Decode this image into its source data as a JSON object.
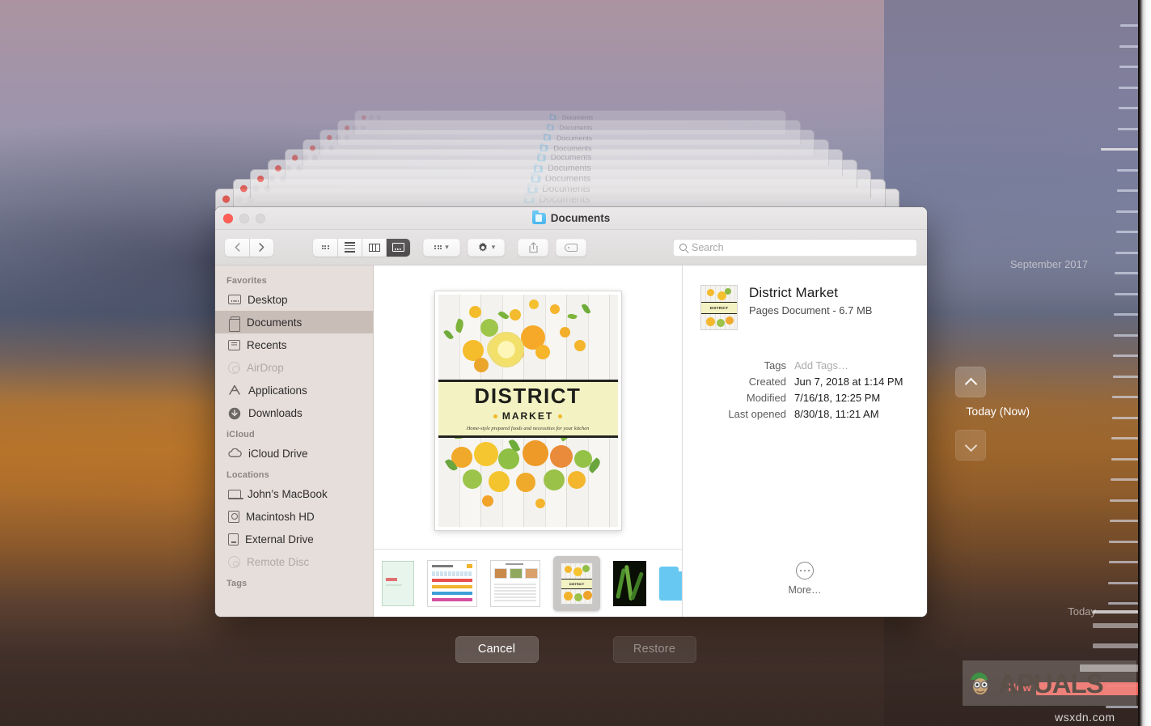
{
  "desktop": {
    "cascade_title": "Documents",
    "cascade_count": 9
  },
  "window": {
    "title": "Documents",
    "folder_icon": "folder-icon",
    "traffic_lights": [
      "close",
      "minimize",
      "zoom"
    ]
  },
  "toolbar": {
    "back_label": "‹",
    "forward_label": "›",
    "views": [
      {
        "name": "icon-view",
        "icon": "grid-icon",
        "active": false
      },
      {
        "name": "list-view",
        "icon": "list-icon",
        "active": false
      },
      {
        "name": "column-view",
        "icon": "columns-icon",
        "active": false
      },
      {
        "name": "gallery-view",
        "icon": "gallery-icon",
        "active": true
      }
    ],
    "group_by": {
      "icon": "grid-icon",
      "chevron": "⌄"
    },
    "action": {
      "icon": "gear-icon",
      "chevron": "⌄"
    },
    "share": {
      "icon": "share-icon"
    },
    "tags": {
      "icon": "tag-icon"
    }
  },
  "search": {
    "icon": "search-icon",
    "placeholder": "Search",
    "value": ""
  },
  "sidebar": {
    "sections": [
      {
        "header": "Favorites",
        "items": [
          {
            "label": "Desktop",
            "icon": "desktop-icon",
            "selected": false,
            "disabled": false
          },
          {
            "label": "Documents",
            "icon": "documents-icon",
            "selected": true,
            "disabled": false
          },
          {
            "label": "Recents",
            "icon": "recents-icon",
            "selected": false,
            "disabled": false
          },
          {
            "label": "AirDrop",
            "icon": "airdrop-icon",
            "selected": false,
            "disabled": true
          },
          {
            "label": "Applications",
            "icon": "applications-icon",
            "selected": false,
            "disabled": false
          },
          {
            "label": "Downloads",
            "icon": "downloads-icon",
            "selected": false,
            "disabled": false
          }
        ]
      },
      {
        "header": "iCloud",
        "items": [
          {
            "label": "iCloud Drive",
            "icon": "cloud-icon",
            "selected": false,
            "disabled": false
          }
        ]
      },
      {
        "header": "Locations",
        "items": [
          {
            "label": "John’s MacBook",
            "icon": "laptop-icon",
            "selected": false,
            "disabled": false
          },
          {
            "label": "Macintosh HD",
            "icon": "harddisk-icon",
            "selected": false,
            "disabled": false
          },
          {
            "label": "External Drive",
            "icon": "externaldrive-icon",
            "selected": false,
            "disabled": false
          },
          {
            "label": "Remote Disc",
            "icon": "disc-icon",
            "selected": false,
            "disabled": true
          }
        ]
      },
      {
        "header": "Tags",
        "items": []
      }
    ]
  },
  "preview": {
    "cover_title": "DISTRICT",
    "cover_subtitle": "MARKET",
    "cover_tagline": "Home-style prepared foods and necessities for your kitchen"
  },
  "filmstrip": {
    "items": [
      {
        "name": "spreadsheet-thumbnail",
        "type": "sheet-green",
        "selected": false
      },
      {
        "name": "chart-thumbnail",
        "type": "sheet-chart",
        "selected": false
      },
      {
        "name": "recipe-page-thumbnail",
        "type": "sheet-photo",
        "selected": false
      },
      {
        "name": "district-market-thumbnail",
        "type": "document",
        "selected": true
      },
      {
        "name": "plant-photo-thumbnail",
        "type": "photo",
        "selected": false
      },
      {
        "name": "folder-thumbnail",
        "type": "folder",
        "selected": false
      },
      {
        "name": "leaf-photo-thumbnail",
        "type": "photo",
        "selected": false
      }
    ]
  },
  "info": {
    "name": "District Market",
    "subtitle": "Pages Document - 6.7 MB",
    "rows": [
      {
        "key": "Tags",
        "value": "Add Tags…",
        "placeholder": true
      },
      {
        "key": "Created",
        "value": "Jun 7, 2018 at 1:14 PM",
        "placeholder": false
      },
      {
        "key": "Modified",
        "value": "7/16/18, 12:25 PM",
        "placeholder": false
      },
      {
        "key": "Last opened",
        "value": "8/30/18, 11:21 AM",
        "placeholder": false
      }
    ],
    "more_label": "More…",
    "more_icon": "ellipsis-circle-icon"
  },
  "actions": {
    "cancel_label": "Cancel",
    "restore_label": "Restore",
    "restore_disabled": true
  },
  "timemachine": {
    "top_label": "September 2017",
    "current_label": "Today (Now)",
    "bottom_label": "Today",
    "now_label": "Now",
    "up_icon": "chevron-up-icon",
    "down_icon": "chevron-down-icon",
    "now_color": "#e8554c"
  },
  "watermarks": {
    "brand_a": "A",
    "brand_rest": "PUALS",
    "site": "wsxdn.com"
  },
  "colors": {
    "accent_blue": "#49b6ee",
    "sidebar_bg": "#e5dedb",
    "selection": "#c9bdb7",
    "close_red": "#ff5f57",
    "now_red": "#e8554c"
  }
}
